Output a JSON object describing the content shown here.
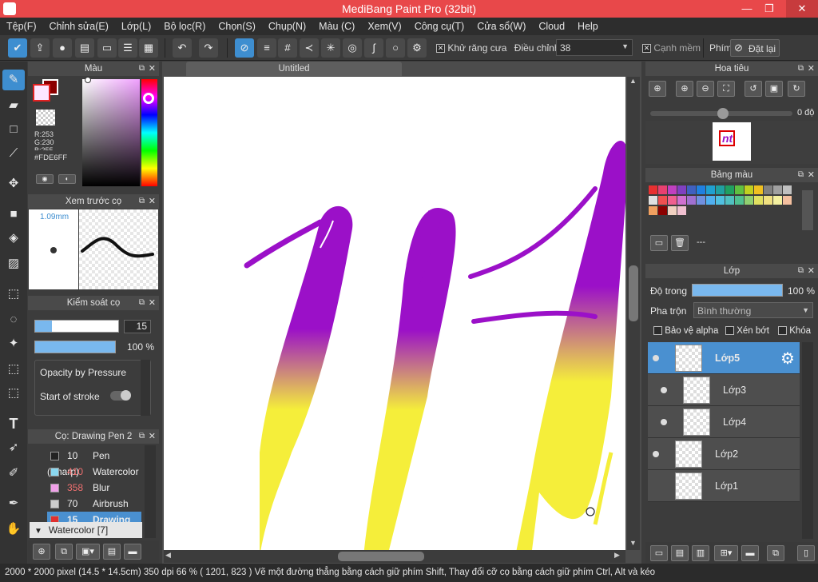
{
  "app": {
    "title": "MediBang Paint Pro (32bit)",
    "min": "—",
    "max": "❐",
    "close": "✕"
  },
  "menu": [
    "Tệp(F)",
    "Chỉnh sửa(E)",
    "Lớp(L)",
    "Bộ lọc(R)",
    "Chọn(S)",
    "Chụp(N)",
    "Màu (C)",
    "Xem(V)",
    "Công cụ(T)",
    "Cửa sổ(W)",
    "Cloud",
    "Help"
  ],
  "toolbar": {
    "antialias_label": "Khử răng cưa",
    "adjust_label": "Điều chỉnh",
    "adjust_value": "38",
    "soft_edge_label": "Cạnh mềm",
    "key_label": "Phím",
    "reset_label": "Đặt lại"
  },
  "color_panel": {
    "title": "Màu",
    "r": "R:253",
    "g": "G:230",
    "b": "B:255",
    "hex": "#FDE6FF",
    "main_color": "#fde6ff",
    "sub_color": "#8b0000"
  },
  "brush_preview": {
    "title": "Xem trước cọ",
    "size": "1.09mm"
  },
  "brush_control": {
    "title": "Kiểm soát cọ",
    "size_value": "15",
    "opacity_value": "100 %",
    "opacity_by_pressure": "Opacity by Pressure",
    "start_stroke": "Start of stroke",
    "size_fill": 0.2,
    "opacity_fill": 1.0
  },
  "brush_list": {
    "title": "Cọ: Drawing Pen 2",
    "items": [
      {
        "size": "10",
        "name": "Pen (Sharp)",
        "color": "#222222",
        "selected": false
      },
      {
        "size": "410",
        "name": "Watercolor",
        "color": "#8ad8f0",
        "selected": false
      },
      {
        "size": "358",
        "name": "Blur",
        "color": "#f0a0e8",
        "selected": false
      },
      {
        "size": "70",
        "name": "Airbrush",
        "color": "#cccccc",
        "selected": false
      },
      {
        "size": "15",
        "name": "Drawing",
        "color": "#e03030",
        "selected": true
      }
    ],
    "group": "Watercolor [7]"
  },
  "canvas": {
    "tab": "Untitled"
  },
  "navigator": {
    "title": "Hoa tiêu",
    "angle": "0 độ"
  },
  "palette": {
    "title": "Bảng màu",
    "name": "---",
    "colors": [
      "#e83030",
      "#e84070",
      "#c040c0",
      "#8040c0",
      "#4060c0",
      "#2080e0",
      "#20a0d0",
      "#20a0a0",
      "#20a060",
      "#60c040",
      "#c0d020",
      "#f0c020",
      "#808080",
      "#a0a0a0",
      "#c0c0c0",
      "#e0e0e0",
      "#f05050",
      "#f06090",
      "#d070d0",
      "#a070d0",
      "#7090e0",
      "#50b0f0",
      "#50c0e0",
      "#50c0c0",
      "#50c090",
      "#90d070",
      "#e0e060",
      "#f0e080",
      "#f4f0a0",
      "#f4c0a0",
      "#f0a060",
      "#8b0000",
      "#f0d0c0",
      "#f0c0d0"
    ]
  },
  "layer_panel": {
    "title": "Lớp",
    "opacity_label": "Độ trong",
    "opacity_value": "100 %",
    "opacity_fill": 1.0,
    "blend_label": "Pha trộn",
    "blend_value": "Bình thường",
    "protect_alpha": "Bảo vệ alpha",
    "clipping": "Xén bớt",
    "lock": "Khóa",
    "layers": [
      {
        "name": "Lớp5",
        "selected": true,
        "indent": false
      },
      {
        "name": "Lớp3",
        "selected": false,
        "indent": true
      },
      {
        "name": "Lớp4",
        "selected": false,
        "indent": true
      },
      {
        "name": "Lớp2",
        "selected": false,
        "indent": false
      },
      {
        "name": "Lớp1",
        "selected": false,
        "indent": false
      }
    ]
  },
  "status": "2000 * 2000 pixel  (14.5 * 14.5cm)  350 dpi   66 %   ( 1201, 823 )   Vẽ một đường thẳng bằng cách giữ phím Shift, Thay đổi cỡ cọ bằng cách giữ phím Ctrl, Alt và kéo"
}
